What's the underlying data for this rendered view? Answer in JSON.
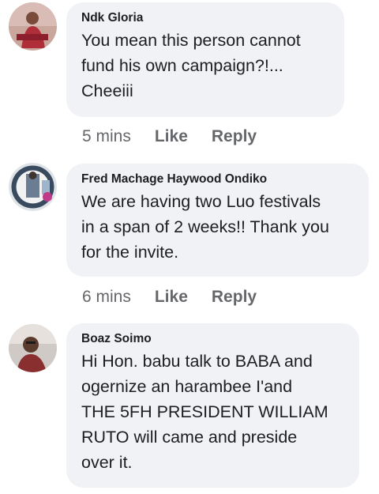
{
  "comments": [
    {
      "author": "Ndk Gloria",
      "lines": [
        "You mean this person cannot",
        "fund his own campaign?!...",
        "Cheeiii"
      ],
      "time": "5 mins",
      "like_label": "Like",
      "reply_label": "Reply"
    },
    {
      "author": "Fred Machage Haywood Ondiko",
      "lines": [
        "We are having two Luo festivals",
        "in a span of 2 weeks!! Thank you",
        "for the invite."
      ],
      "time": "6 mins",
      "like_label": "Like",
      "reply_label": "Reply"
    },
    {
      "author": "Boaz Soimo",
      "lines": [
        "Hi Hon. babu talk to BABA and",
        "ogernize an harambee  I'and",
        "THE 5FH PRESIDENT WILLIAM",
        "RUTO will came and preside",
        "over it."
      ],
      "time": null,
      "like_label": null,
      "reply_label": null
    }
  ]
}
